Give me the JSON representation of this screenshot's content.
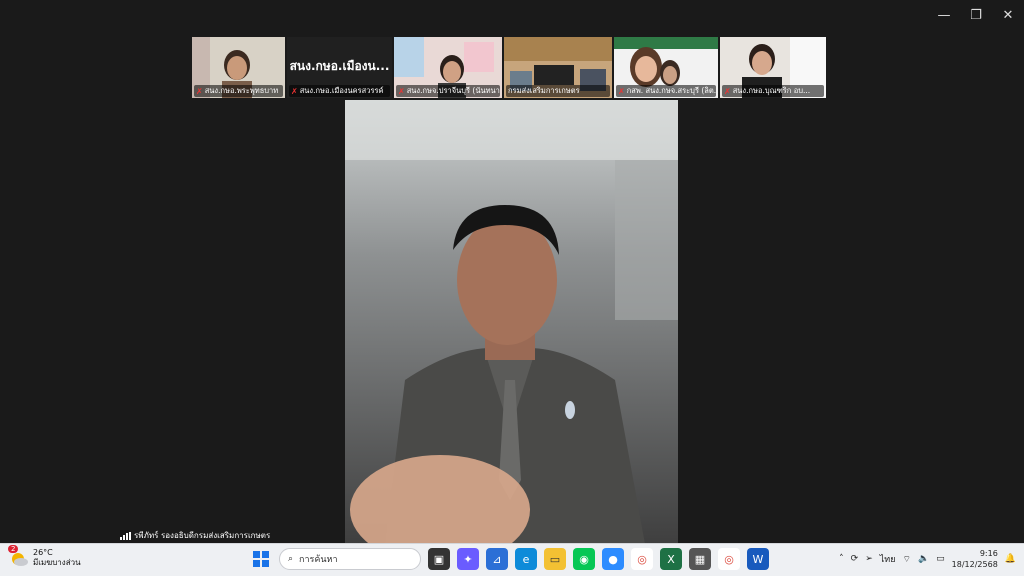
{
  "window": {
    "minimize_icon": "minimize-icon",
    "maximize_icon": "restore-icon",
    "close_icon": "close-icon"
  },
  "gallery": [
    {
      "label": "สนง.กษอ.พระพุทธบาท",
      "muted": true
    },
    {
      "label": "สนง.กษอ.เมืองนครสวรรค์",
      "muted": true,
      "title": "สนง.กษอ.เมืองน..."
    },
    {
      "label": "สนง.กษจ.ปราจีนบุรี (นันทนา...",
      "muted": true
    },
    {
      "label": "กรมส่งเสริมการเกษตร",
      "muted": false
    },
    {
      "label": "กสพ. สนง.กษจ.สระบุรี (ลิต...",
      "muted": true
    },
    {
      "label": "สนง.กษอ.บุณฑริก อบ...",
      "muted": true
    }
  ],
  "speaker": {
    "name": "รพีภัทร์ รองอธิบดีกรมส่งเสริมการเกษตร"
  },
  "taskbar": {
    "weather": {
      "temp": "26°C",
      "desc": "มีเมฆบางส่วน",
      "badge": "2"
    },
    "search_placeholder": "การค้นหา",
    "tray_lang": "ไทย",
    "time": "9:16",
    "date": "18/12/2568"
  },
  "colors": {
    "background": "#1a1a1a",
    "taskbar": "#eef0f3",
    "muted_mic": "#e33333"
  }
}
